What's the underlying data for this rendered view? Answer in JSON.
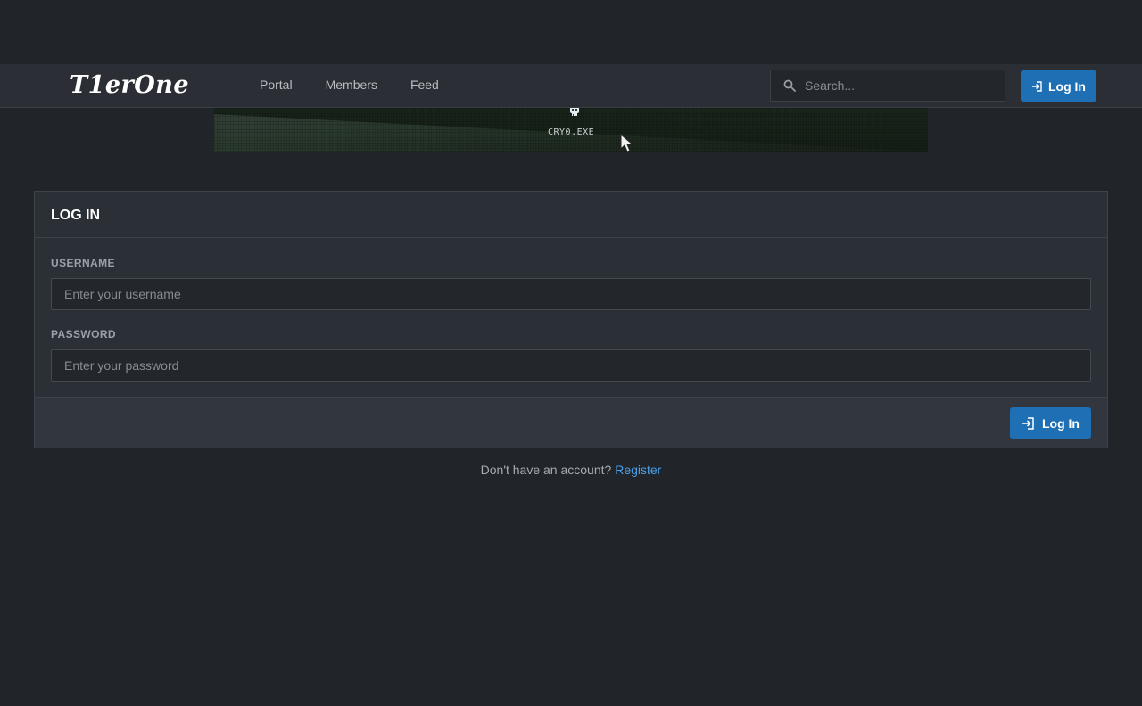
{
  "banner": {
    "caption": "CRY0.EXE"
  },
  "header": {
    "logo": "T1erOne",
    "nav": [
      "Portal",
      "Members",
      "Feed"
    ],
    "search_placeholder": "Search...",
    "login_label": "Log In"
  },
  "login": {
    "title": "LOG IN",
    "username_label": "USERNAME",
    "username_placeholder": "Enter your username",
    "password_label": "PASSWORD",
    "password_placeholder": "Enter your password",
    "submit_label": "Log In"
  },
  "register": {
    "prompt": "Don't have an account?",
    "link": "Register"
  },
  "colors": {
    "accent": "#1f6fb5",
    "link": "#4a9fe8",
    "background": "#212428",
    "panel": "#2b2f36"
  }
}
